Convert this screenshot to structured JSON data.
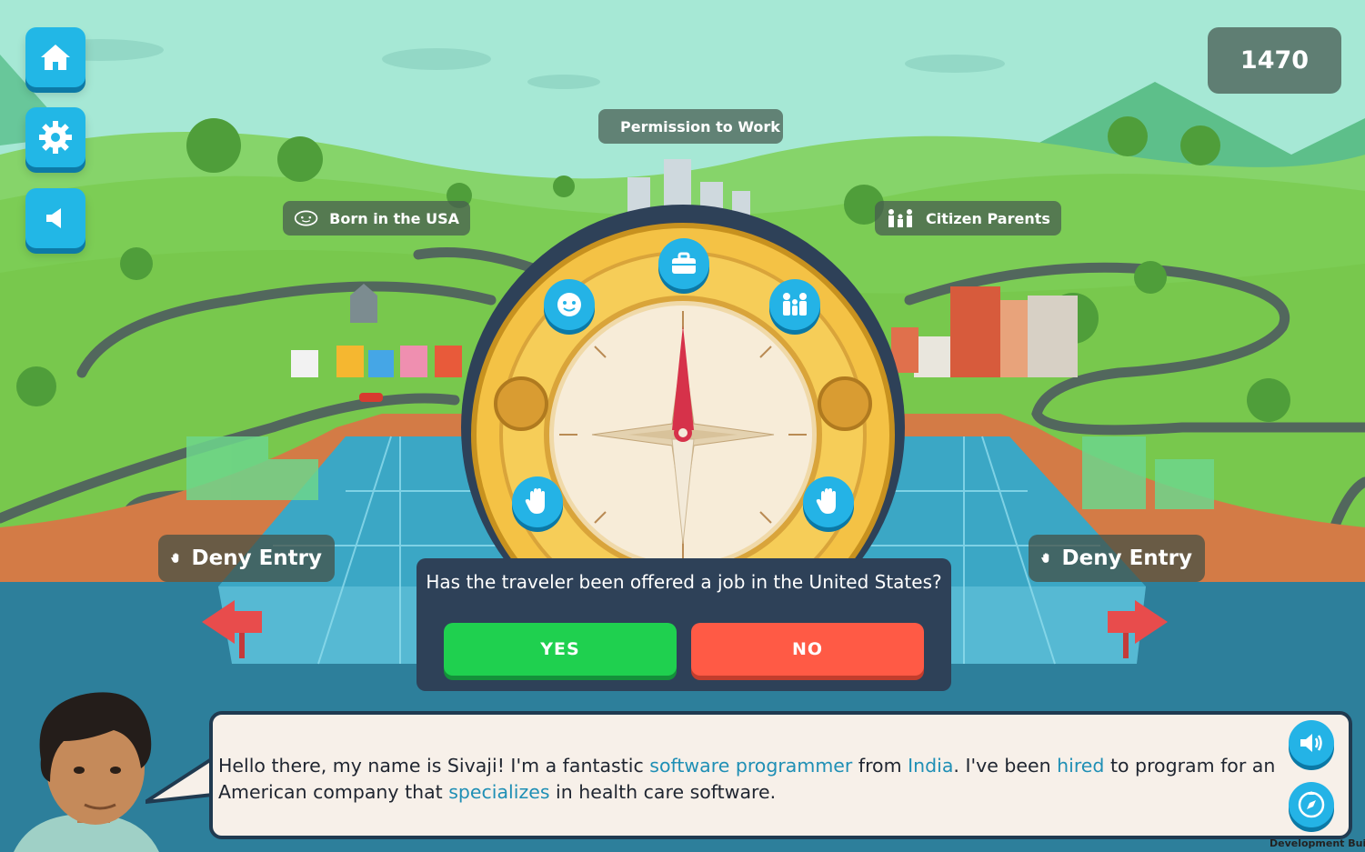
{
  "hud": {
    "score": "1470",
    "home_icon": "home-icon",
    "settings_icon": "gear-icon",
    "sound_icon": "speaker-icon"
  },
  "compass": {
    "labels": {
      "work": "Permission to Work",
      "born": "Born in the USA",
      "parents": "Citizen Parents"
    },
    "deny_left": "Deny Entry",
    "deny_right": "Deny Entry"
  },
  "question": {
    "text": "Has the traveler been offered a job in the United States?",
    "yes_label": "YES",
    "no_label": "NO"
  },
  "dialogue": {
    "p1": "Hello there, my name is Sivaji! I'm a fantastic ",
    "k1": "software programmer",
    "p2": " from ",
    "k2": "India",
    "p3": ". I've been ",
    "k3": "hired",
    "p4": " to program for an American company that ",
    "k4": "specializes",
    "p5": " in health care software."
  },
  "footer": {
    "dev_build": "Development Build"
  },
  "colors": {
    "accent": "#22b7e6",
    "yes": "#1fd04f",
    "no": "#ff5a45",
    "keyword": "#1f8fb5"
  }
}
